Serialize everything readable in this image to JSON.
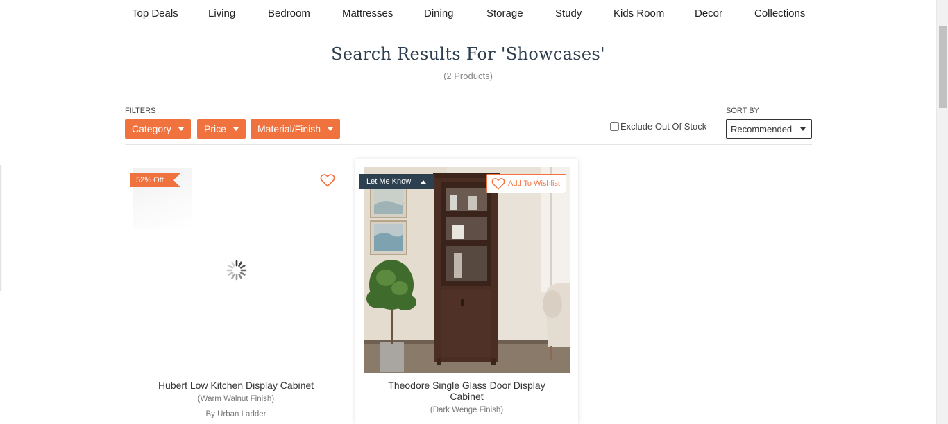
{
  "nav": {
    "items": [
      "Top Deals",
      "Living",
      "Bedroom",
      "Mattresses",
      "Dining",
      "Storage",
      "Study",
      "Kids Room",
      "Decor",
      "Collections"
    ]
  },
  "search": {
    "title": "Search Results For 'Showcases'",
    "count": "(2 Products)"
  },
  "filters": {
    "label": "FILTERS",
    "buttons": [
      "Category",
      "Price",
      "Material/Finish"
    ],
    "exclude_label": "Exclude Out Of Stock",
    "exclude_checked": false
  },
  "sort": {
    "label": "SORT BY",
    "selected": "Recommended"
  },
  "products": [
    {
      "badge": "52% Off",
      "name": "Hubert Low Kitchen Display Cabinet",
      "finish": "(Warm Walnut Finish)",
      "brand": "By Urban Ladder",
      "image_state": "loading"
    },
    {
      "stock_button": "Let Me Know",
      "wishlist_label": "Add To Wishlist",
      "name": "Theodore Single Glass Door Display Cabinet",
      "finish": "(Dark Wenge Finish)"
    }
  ],
  "colors": {
    "accent": "#f0733f",
    "dark_badge": "#2d4050",
    "title": "#2d3e4e"
  }
}
